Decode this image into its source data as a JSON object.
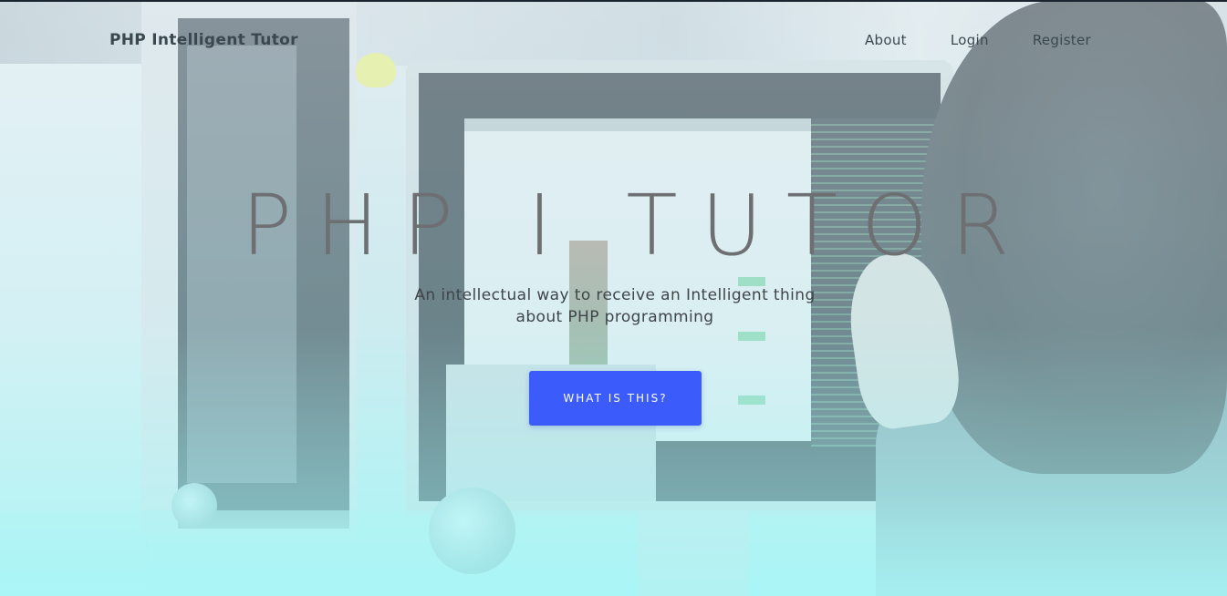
{
  "nav": {
    "brand": "PHP Intelligent Tutor",
    "links": [
      {
        "label": "About"
      },
      {
        "label": "Login"
      },
      {
        "label": "Register"
      }
    ]
  },
  "hero": {
    "title": "PHP I TUTOR",
    "subtitle": "An intellectual way to receive an Intelligent thing about PHP programming",
    "cta_label": "WHAT IS THIS?",
    "background_image": "office-workstation-photo"
  },
  "colors": {
    "accent": "#3b5bfb",
    "title": "#6d6f72",
    "text": "#3c4850"
  }
}
